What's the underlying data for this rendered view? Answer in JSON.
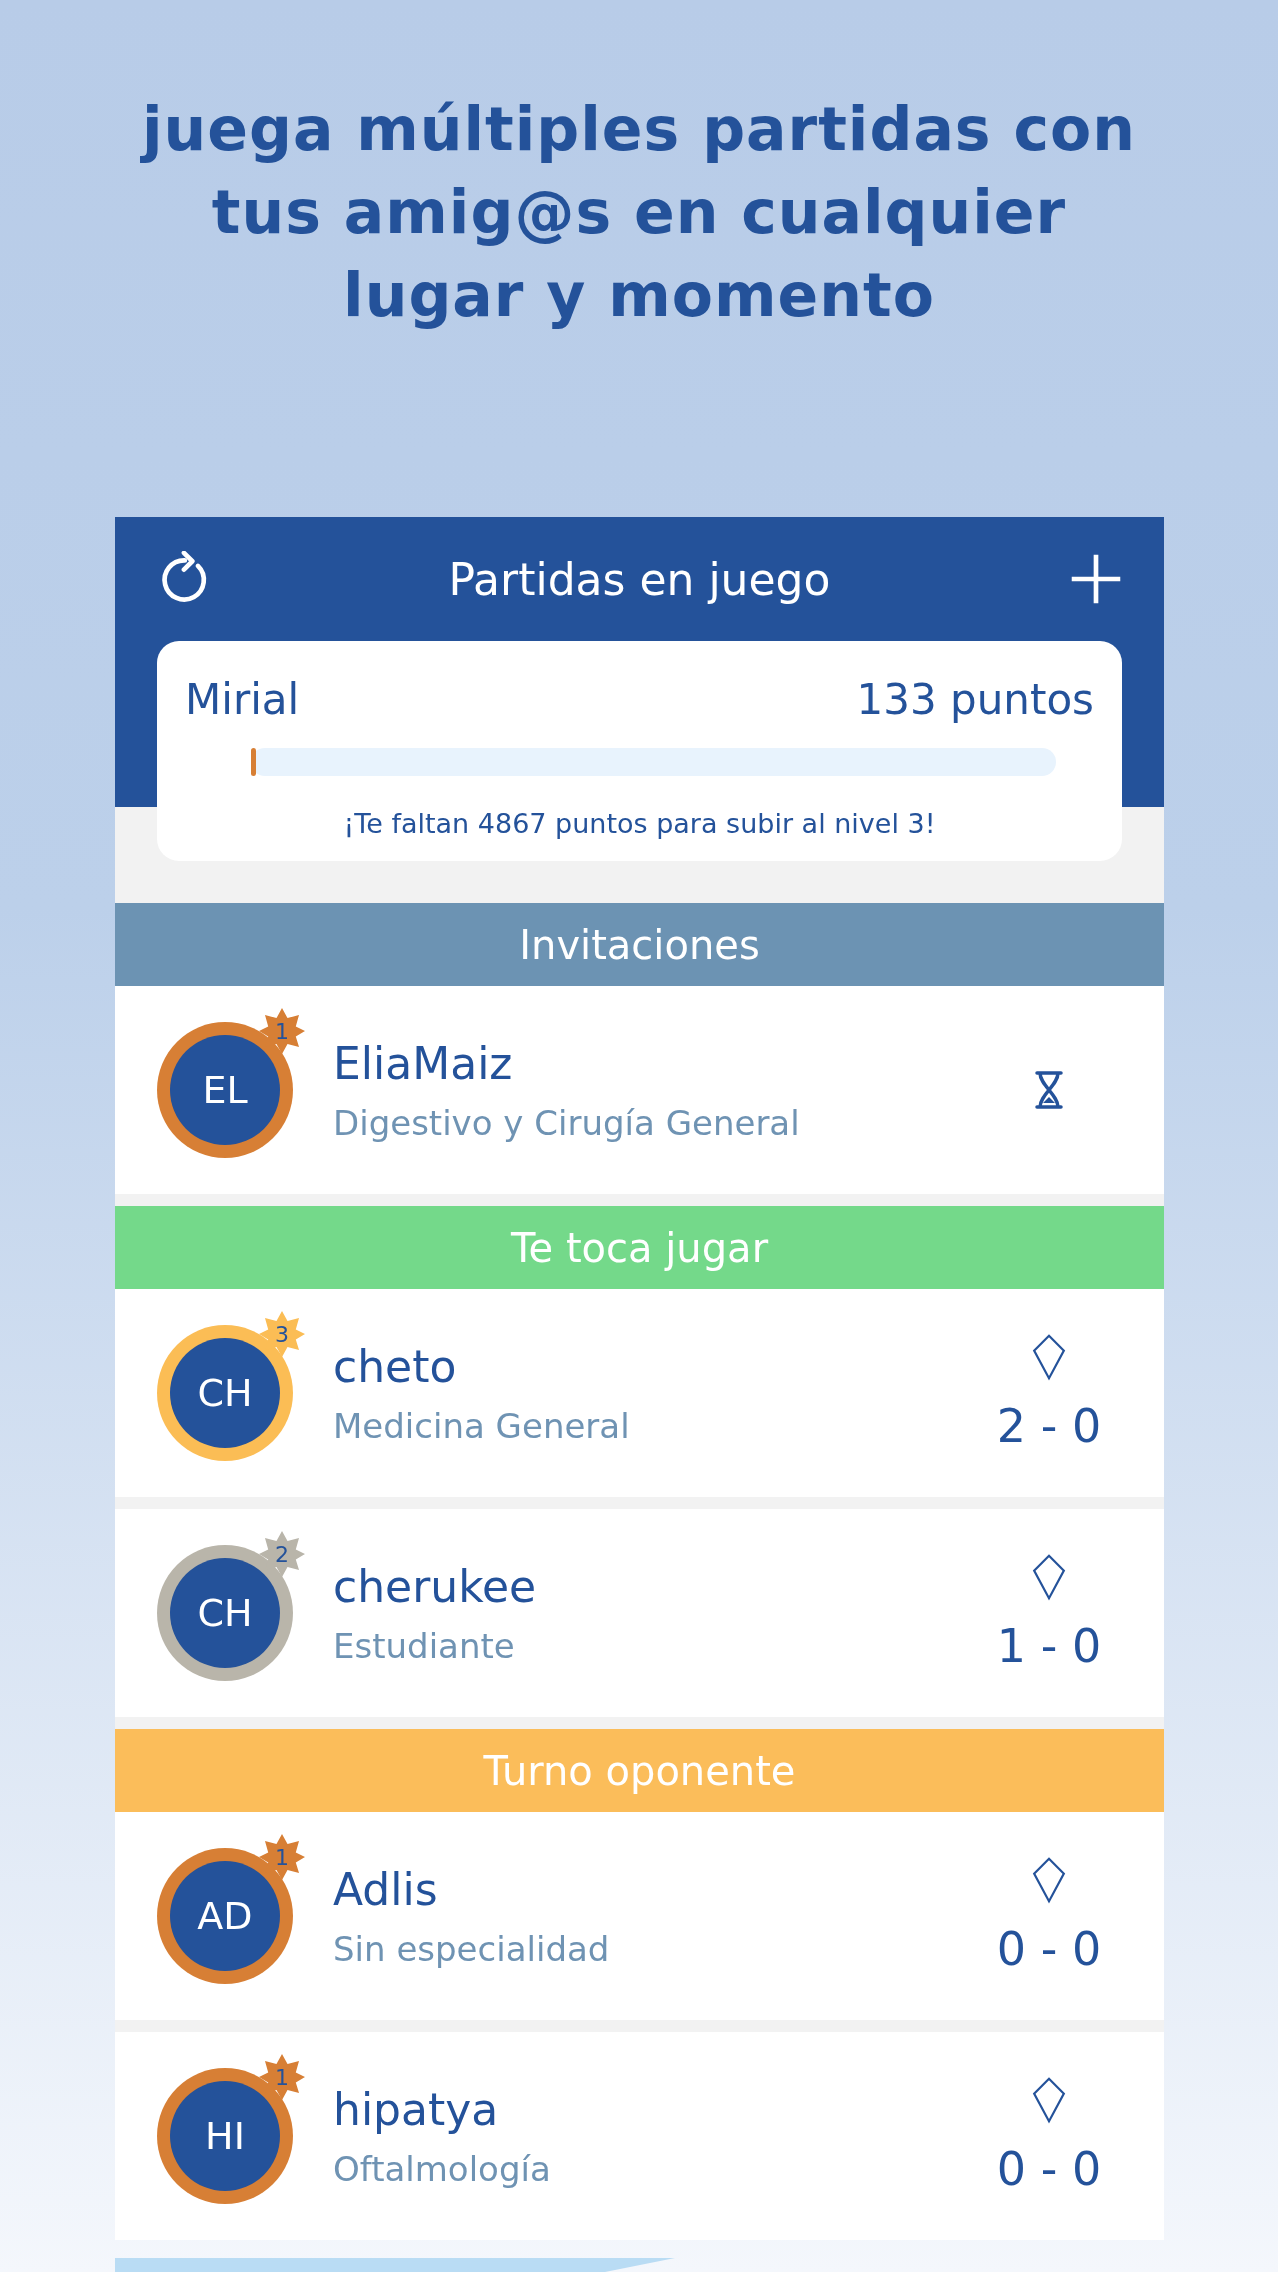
{
  "heading": "juega múltiples partidas con tus amig@s en cualquier lugar y momento",
  "header": {
    "title": "Partidas en juego"
  },
  "profile": {
    "name": "Mirial",
    "points": "133 puntos",
    "level": 0.005,
    "message": "¡Te faltan 4867 puntos para subir al nivel 3!"
  },
  "sections": [
    {
      "title": "Invitaciones",
      "color": "#6c93b3",
      "games": [
        {
          "initials": "EL",
          "badge": "1",
          "color": "#d77f35",
          "name": "EliaMaiz",
          "specialty": "Digestivo y Cirugía General",
          "kind": "pending"
        }
      ]
    },
    {
      "title": "Te toca jugar",
      "color": "#74d98a",
      "games": [
        {
          "initials": "CH",
          "badge": "3",
          "color": "#fbbd55",
          "name": "cheto",
          "specialty": "Medicina General",
          "kind": "score",
          "score": "2 - 0"
        },
        {
          "initials": "CH",
          "badge": "2",
          "color": "#b9b5aa",
          "name": "cherukee",
          "specialty": "Estudiante",
          "kind": "score",
          "score": "1 - 0"
        }
      ]
    },
    {
      "title": "Turno oponente",
      "color": "#fbbd5a",
      "games": [
        {
          "initials": "AD",
          "badge": "1",
          "color": "#d77f35",
          "name": "Adlis",
          "specialty": "Sin especialidad",
          "kind": "score",
          "score": "0 - 0"
        },
        {
          "initials": "HI",
          "badge": "1",
          "color": "#d77f35",
          "name": "hipatya",
          "specialty": "Oftalmología",
          "kind": "score",
          "score": "0 - 0"
        }
      ]
    }
  ]
}
